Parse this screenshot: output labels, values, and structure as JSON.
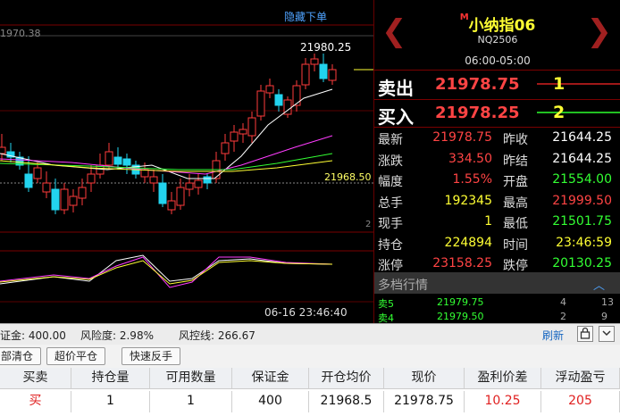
{
  "chart": {
    "hide_order_label": "隐藏下单",
    "price_left": "1970.38",
    "price_high_label": "21980.25",
    "price_last_label": "21968.50",
    "indicator_value": "2",
    "time_label": "06-16 23:46:40"
  },
  "quote": {
    "marker": "M",
    "name": "小纳指06",
    "code": "NQ2506",
    "session": "06:00-05:00",
    "sell_label": "卖出",
    "sell_price": "21978.75",
    "sell_qty": "1",
    "buy_label": "买入",
    "buy_price": "21978.25",
    "buy_qty": "2",
    "rows": [
      {
        "l1": "最新",
        "v1": "21978.75",
        "c1": "red",
        "l2": "昨收",
        "v2": "21644.25",
        "c2": "white"
      },
      {
        "l1": "涨跌",
        "v1": "334.50",
        "c1": "red",
        "l2": "昨结",
        "v2": "21644.25",
        "c2": "white"
      },
      {
        "l1": "幅度",
        "v1": "1.55%",
        "c1": "red",
        "l2": "开盘",
        "v2": "21554.00",
        "c2": "green"
      },
      {
        "l1": "总手",
        "v1": "192345",
        "c1": "yellow",
        "l2": "最高",
        "v2": "21999.50",
        "c2": "red"
      },
      {
        "l1": "现手",
        "v1": "1",
        "c1": "yellow",
        "l2": "最低",
        "v2": "21501.75",
        "c2": "green"
      },
      {
        "l1": "持仓",
        "v1": "224894",
        "c1": "yellow",
        "l2": "时间",
        "v2": "23:46:59",
        "c2": "yellow"
      },
      {
        "l1": "涨停",
        "v1": "23158.25",
        "c1": "red",
        "l2": "跌停",
        "v2": "20130.25",
        "c2": "green"
      }
    ],
    "depth_title": "多档行情",
    "depth_toggle": "︿",
    "depth": [
      {
        "label": "卖5",
        "price": "21979.75",
        "qty": "4",
        "qty2": "13"
      },
      {
        "label": "卖4",
        "price": "21979.50",
        "qty": "2",
        "qty2": "9"
      }
    ]
  },
  "account": {
    "margin": "证金: 400.00",
    "risk": "风险度: 2.98%",
    "risk_line": "风控线: 266.67",
    "refresh": "刷新",
    "lock_icon": "lock-icon",
    "dropdown_icon": "chevron-down-icon"
  },
  "buttons": {
    "close_all": "部清仓",
    "close_at_market": "超价平仓",
    "quick_reverse": "快速反手"
  },
  "table": {
    "headers": [
      "买卖",
      "持仓量",
      "可用数量",
      "保证金",
      "开仓均价",
      "现价",
      "盈利价差",
      "浮动盈亏"
    ],
    "row": [
      "买",
      "1",
      "1",
      "400",
      "21968.5",
      "21978.75",
      "10.25",
      "205"
    ]
  },
  "colors": {
    "up": "#ff4444",
    "down": "#33ff33",
    "accent_yellow": "#ffff33",
    "border_red": "#7a0000"
  }
}
